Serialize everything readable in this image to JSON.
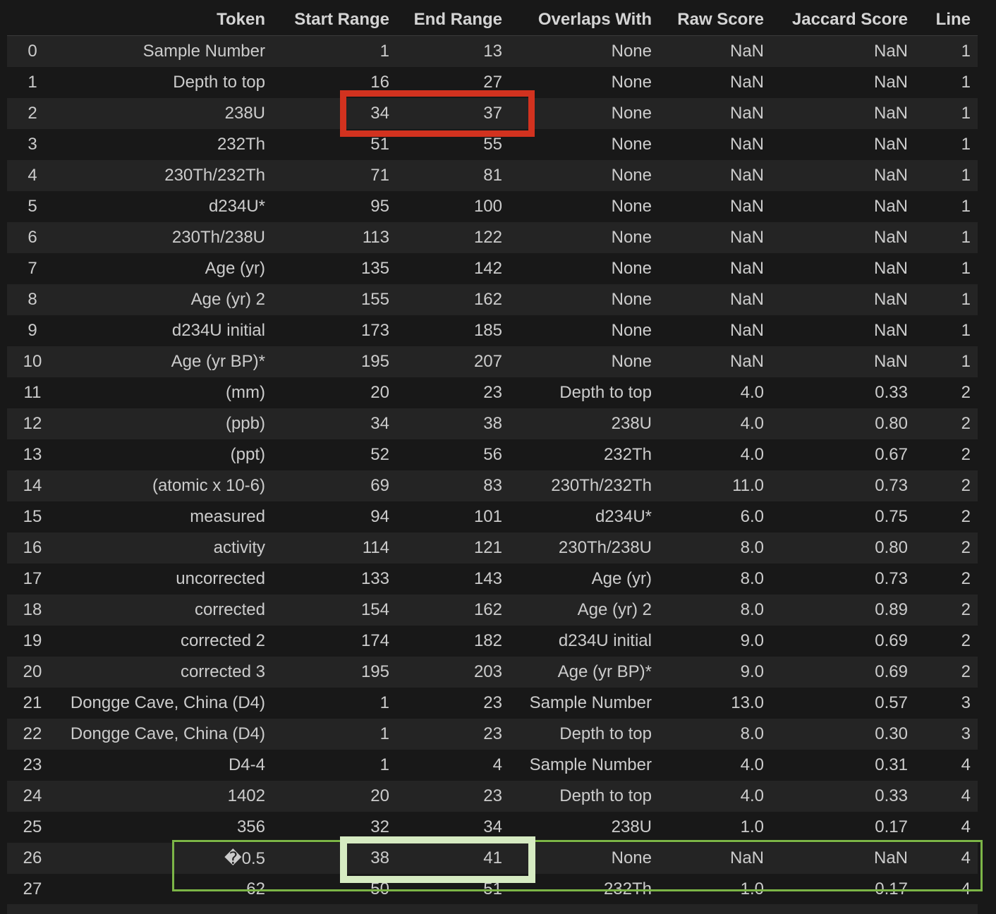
{
  "columns": [
    "",
    "Token",
    "Start Range",
    "End Range",
    "Overlaps With",
    "Raw Score",
    "Jaccard Score",
    "Line"
  ],
  "rows": [
    [
      "0",
      "Sample Number",
      "1",
      "13",
      "None",
      "NaN",
      "NaN",
      "1"
    ],
    [
      "1",
      "Depth to top",
      "16",
      "27",
      "None",
      "NaN",
      "NaN",
      "1"
    ],
    [
      "2",
      "238U",
      "34",
      "37",
      "None",
      "NaN",
      "NaN",
      "1"
    ],
    [
      "3",
      "232Th",
      "51",
      "55",
      "None",
      "NaN",
      "NaN",
      "1"
    ],
    [
      "4",
      "230Th/232Th",
      "71",
      "81",
      "None",
      "NaN",
      "NaN",
      "1"
    ],
    [
      "5",
      "d234U*",
      "95",
      "100",
      "None",
      "NaN",
      "NaN",
      "1"
    ],
    [
      "6",
      "230Th/238U",
      "113",
      "122",
      "None",
      "NaN",
      "NaN",
      "1"
    ],
    [
      "7",
      "Age (yr)",
      "135",
      "142",
      "None",
      "NaN",
      "NaN",
      "1"
    ],
    [
      "8",
      "Age (yr) 2",
      "155",
      "162",
      "None",
      "NaN",
      "NaN",
      "1"
    ],
    [
      "9",
      "d234U initial",
      "173",
      "185",
      "None",
      "NaN",
      "NaN",
      "1"
    ],
    [
      "10",
      "Age (yr BP)*",
      "195",
      "207",
      "None",
      "NaN",
      "NaN",
      "1"
    ],
    [
      "11",
      "(mm)",
      "20",
      "23",
      "Depth to top",
      "4.0",
      "0.33",
      "2"
    ],
    [
      "12",
      "(ppb)",
      "34",
      "38",
      "238U",
      "4.0",
      "0.80",
      "2"
    ],
    [
      "13",
      "(ppt)",
      "52",
      "56",
      "232Th",
      "4.0",
      "0.67",
      "2"
    ],
    [
      "14",
      "(atomic x 10-6)",
      "69",
      "83",
      "230Th/232Th",
      "11.0",
      "0.73",
      "2"
    ],
    [
      "15",
      "measured",
      "94",
      "101",
      "d234U*",
      "6.0",
      "0.75",
      "2"
    ],
    [
      "16",
      "activity",
      "114",
      "121",
      "230Th/238U",
      "8.0",
      "0.80",
      "2"
    ],
    [
      "17",
      "uncorrected",
      "133",
      "143",
      "Age (yr)",
      "8.0",
      "0.73",
      "2"
    ],
    [
      "18",
      "corrected",
      "154",
      "162",
      "Age (yr) 2",
      "8.0",
      "0.89",
      "2"
    ],
    [
      "19",
      "corrected 2",
      "174",
      "182",
      "d234U initial",
      "9.0",
      "0.69",
      "2"
    ],
    [
      "20",
      "corrected 3",
      "195",
      "203",
      "Age (yr BP)*",
      "9.0",
      "0.69",
      "2"
    ],
    [
      "21",
      "Dongge Cave, China (D4)",
      "1",
      "23",
      "Sample Number",
      "13.0",
      "0.57",
      "3"
    ],
    [
      "22",
      "Dongge Cave, China (D4)",
      "1",
      "23",
      "Depth to top",
      "8.0",
      "0.30",
      "3"
    ],
    [
      "23",
      "D4-4",
      "1",
      "4",
      "Sample Number",
      "4.0",
      "0.31",
      "4"
    ],
    [
      "24",
      "1402",
      "20",
      "23",
      "Depth to top",
      "4.0",
      "0.33",
      "4"
    ],
    [
      "25",
      "356",
      "32",
      "34",
      "238U",
      "1.0",
      "0.17",
      "4"
    ],
    [
      "26",
      "�0.5",
      "38",
      "41",
      "None",
      "NaN",
      "NaN",
      "4"
    ],
    [
      "27",
      "62",
      "50",
      "51",
      "232Th",
      "1.0",
      "0.17",
      "4"
    ]
  ],
  "colors": {
    "background": "#181818",
    "row_stripe": "#242424",
    "text": "#cccccc",
    "highlight_red": "#d2321f",
    "highlight_green": "#7cb547",
    "highlight_green_light": "#d6ebc2"
  }
}
